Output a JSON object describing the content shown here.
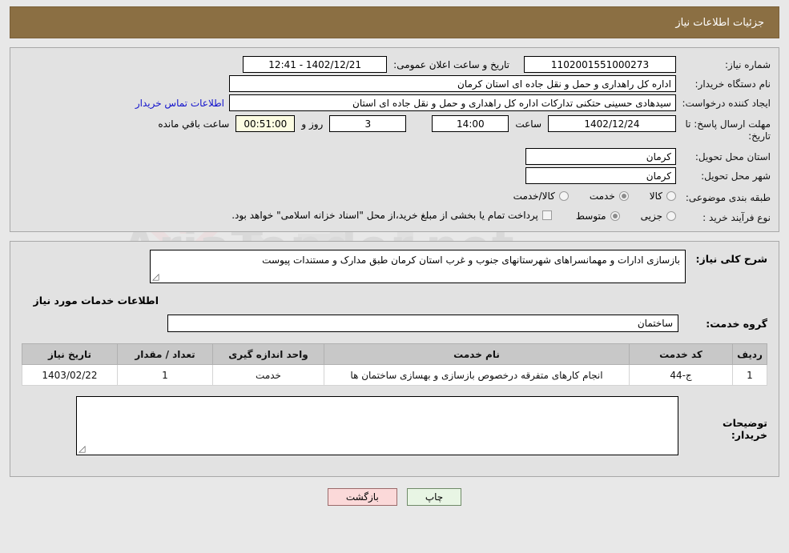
{
  "header": {
    "title": "جزئیات اطلاعات نیاز",
    "bg_color": "#8b6f43"
  },
  "watermark": {
    "text": "AriaTender.net"
  },
  "form": {
    "need_number_label": "شماره نیاز:",
    "need_number_value": "1102001551000273",
    "announce_datetime_label": "تاریخ و ساعت اعلان عمومی:",
    "announce_datetime_value": "1402/12/21 - 12:41",
    "buyer_org_label": "نام دستگاه خریدار:",
    "buyer_org_value": "اداره کل راهداری و حمل و نقل جاده ای استان کرمان",
    "requester_label": "ایجاد کننده درخواست:",
    "requester_value": "سیدهادی حسینی حتکنی تدارکات اداره کل راهداری و حمل و نقل جاده ای استان",
    "contact_link": "اطلاعات تماس خریدار",
    "deadline_label": "مهلت ارسال پاسخ: تا تاریخ:",
    "deadline_date": "1402/12/24",
    "hour_label": "ساعت",
    "hour_value": "14:00",
    "days_value": "3",
    "days_label": "روز و",
    "timer_value": "00:51:00",
    "timer_label": "ساعت باقي مانده",
    "province_label": "استان محل تحویل:",
    "province_value": "کرمان",
    "city_label": "شهر محل تحویل:",
    "city_value": "کرمان",
    "category_label": "طبقه بندی موضوعی:",
    "category_options": [
      {
        "label": "کالا",
        "selected": false
      },
      {
        "label": "خدمت",
        "selected": true
      },
      {
        "label": "کالا/خدمت",
        "selected": false
      }
    ],
    "process_label": "نوع فرآیند خرید :",
    "process_options": [
      {
        "label": "جزیی",
        "selected": false
      },
      {
        "label": "متوسط",
        "selected": true
      }
    ],
    "treasury_note": "پرداخت تمام یا بخشی از مبلغ خرید،از محل \"اسناد خزانه اسلامی\" خواهد بود.",
    "treasury_checked": false
  },
  "description": {
    "label": "شرح کلی نیاز:",
    "value": "بازسازی ادارات و مهمانسراهای شهرستانهای جنوب و غرب استان کرمان طبق مدارک و مستندات پیوست"
  },
  "services_section": {
    "heading": "اطلاعات خدمات مورد نیاز",
    "group_label": "گروه خدمت:",
    "group_value": "ساختمان"
  },
  "table": {
    "columns": [
      "ردیف",
      "کد خدمت",
      "نام خدمت",
      "واحد اندازه گیری",
      "تعداد / مقدار",
      "تاریخ نیاز"
    ],
    "rows": [
      {
        "row": "1",
        "code": "ج-44",
        "name": "انجام کارهای متفرقه درخصوص بازسازی و بهسازی ساختمان ها",
        "unit": "خدمت",
        "quantity": "1",
        "need_date": "1403/02/22"
      }
    ]
  },
  "buyer_notes": {
    "label": "توضیحات خریدار:",
    "value": ""
  },
  "buttons": {
    "print": "چاپ",
    "back": "بازگشت"
  }
}
